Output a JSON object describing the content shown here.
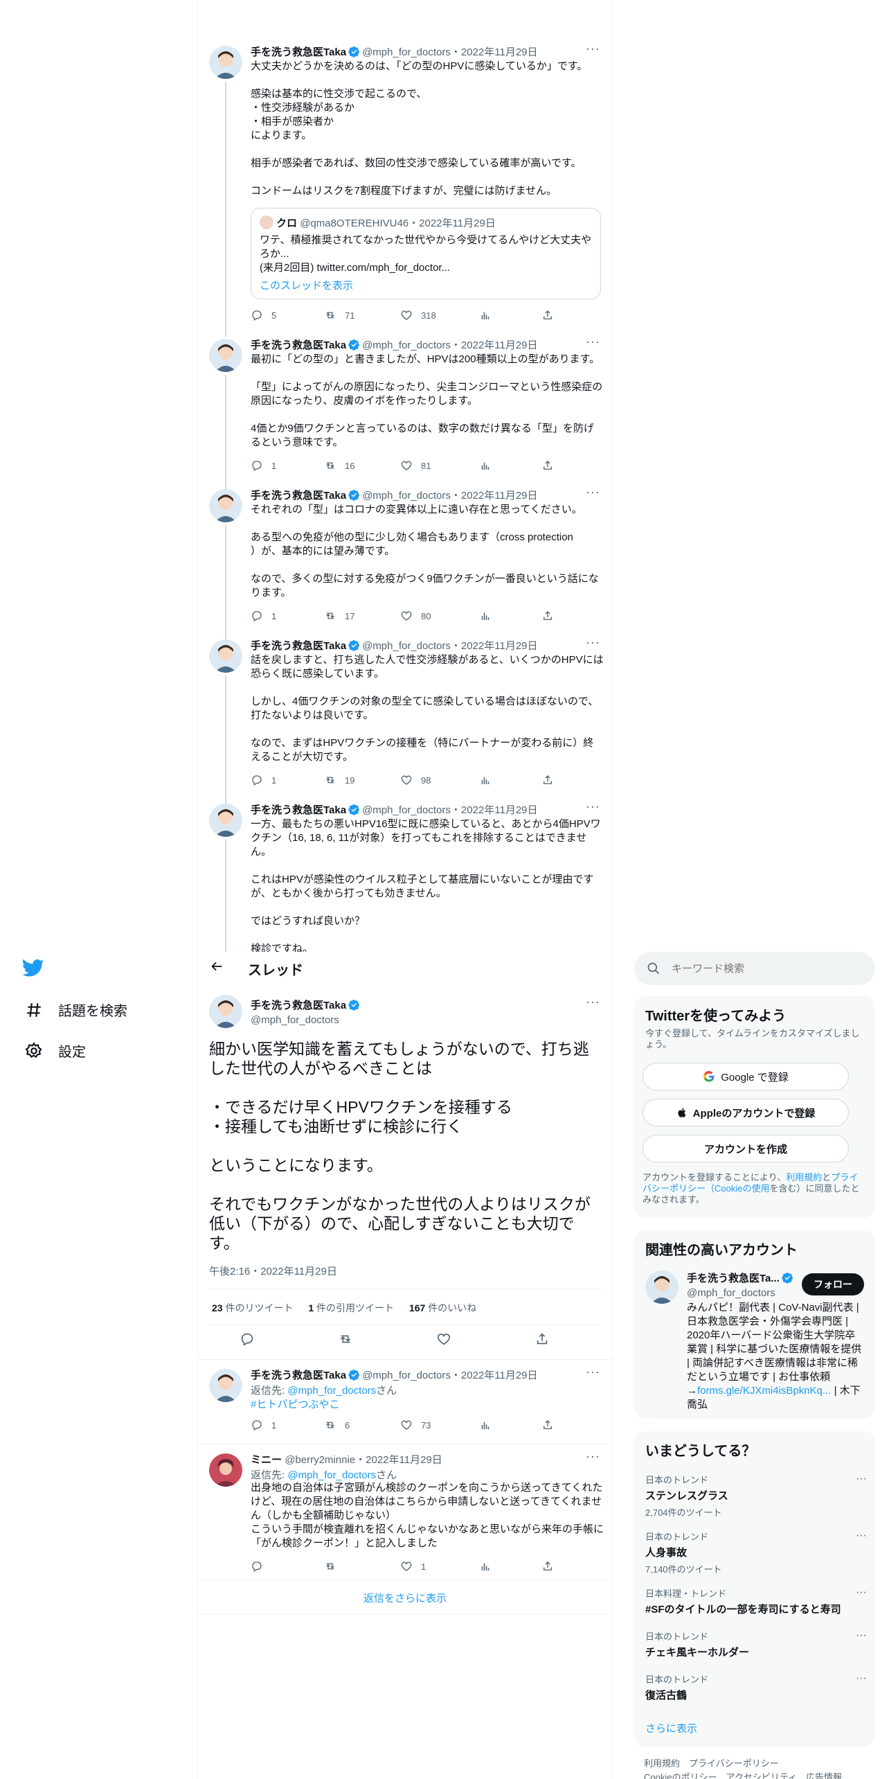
{
  "thread_tweets": [
    {
      "name": "手を洗う救急医Taka",
      "handle": "@mph_for_doctors",
      "date": "2022年11月29日",
      "body": "大丈夫かどうかを決めるのは、「どの型のHPVに感染しているか」です。\n\n感染は基本的に性交渉で起こるので、\n・性交渉経験があるか\n・相手が感染者か\nによります。\n\n相手が感染者であれば、数回の性交渉で感染している確率が高いです。\n\nコンドームはリスクを7割程度下げますが、完璧には防げません。",
      "quote": {
        "name": "クロ",
        "handle": "@qma8OTEREHIVU46",
        "date": "2022年11月29日",
        "text": "ワテ、積極推奨されてなかった世代やから今受けてるんやけど大丈夫やろか...\n(来月2回目) twitter.com/mph_for_doctor...",
        "show_thread": "このスレッドを表示"
      },
      "replies": "5",
      "retweets": "71",
      "likes": "318"
    },
    {
      "name": "手を洗う救急医Taka",
      "handle": "@mph_for_doctors",
      "date": "2022年11月29日",
      "body": "最初に「どの型の」と書きましたが、HPVは200種類以上の型があります。\n\n「型」によってがんの原因になったり、尖圭コンジローマという性感染症の原因になったり、皮膚のイボを作ったりします。\n\n4価とか9価ワクチンと言っているのは、数字の数だけ異なる「型」を防げるという意味です。",
      "replies": "1",
      "retweets": "16",
      "likes": "81"
    },
    {
      "name": "手を洗う救急医Taka",
      "handle": "@mph_for_doctors",
      "date": "2022年11月29日",
      "body": "それぞれの「型」はコロナの変異体以上に遠い存在と思ってください。\n\nある型への免疫が他の型に少し効く場合もあります（cross protection\n）が、基本的には望み薄です。\n\nなので、多くの型に対する免疫がつく9価ワクチンが一番良いという話になります。",
      "replies": "1",
      "retweets": "17",
      "likes": "80"
    },
    {
      "name": "手を洗う救急医Taka",
      "handle": "@mph_for_doctors",
      "date": "2022年11月29日",
      "body": "話を戻しますと、打ち逃した人で性交渉経験があると、いくつかのHPVには恐らく既に感染しています。\n\nしかし、4価ワクチンの対象の型全てに感染している場合はほぼないので、打たないよりは良いです。\n\nなので、まずはHPVワクチンの接種を（特にパートナーが変わる前に）終えることが大切です。",
      "replies": "1",
      "retweets": "19",
      "likes": "98"
    },
    {
      "name": "手を洗う救急医Taka",
      "handle": "@mph_for_doctors",
      "date": "2022年11月29日",
      "body": "一方、最もたちの悪いHPV16型に既に感染していると、あとから4価HPVワクチン（16, 18, 6, 11が対象）を打ってもこれを排除することはできません。\n\nこれはHPVが感染性のウイルス粒子として基底層にいないことが理由ですが、ともかく後から打っても効きません。\n\nではどうすれば良いか？\n\n検診ですね。"
    }
  ],
  "nav": {
    "explore_label": "話題を検索",
    "settings_label": "設定"
  },
  "header": {
    "title": "スレッド"
  },
  "main_tweet": {
    "name": "手を洗う救急医Taka",
    "handle": "@mph_for_doctors",
    "body": "細かい医学知識を蓄えてもしょうがないので、打ち逃した世代の人がやるべきことは\n\n・できるだけ早くHPVワクチンを接種する\n・接種しても油断せずに検診に行く\n\nということになります。\n\nそれでもワクチンがなかった世代の人よりはリスクが低い（下がる）ので、心配しすぎないことも大切です。",
    "timestamp": "午後2:16・2022年11月29日",
    "retweet_count": "23",
    "retweet_label": "件のリツイート",
    "quote_count": "1",
    "quote_label": "件の引用ツイート",
    "like_count": "167",
    "like_label": "件のいいね"
  },
  "replies": [
    {
      "name": "手を洗う救急医Taka",
      "handle": "@mph_for_doctors",
      "date": "2022年11月29日",
      "reply_prefix": "返信先: ",
      "reply_to": "@mph_for_doctors",
      "reply_suffix": "さん",
      "body": "#ヒトパピつぶやこ",
      "replies": "1",
      "retweets": "6",
      "likes": "73"
    },
    {
      "name": "ミニー",
      "handle": "@berry2minnie",
      "date": "2022年11月29日",
      "reply_prefix": "返信先: ",
      "reply_to": "@mph_for_doctors",
      "reply_suffix": "さん",
      "body": "出身地の自治体は子宮頸がん検診のクーポンを向こうから送ってきてくれたけど、現在の居住地の自治体はこちらから申請しないと送ってきてくれません（しかも全額補助じゃない）\nこういう手間が検査離れを招くんじゃないかなあと思いながら来年の手帳に「がん検診クーポン！」と記入しました",
      "replies": "",
      "retweets": "",
      "likes": "1"
    }
  ],
  "show_more_replies": "返信をさらに表示",
  "search": {
    "placeholder": "キーワード検索"
  },
  "signup": {
    "title": "Twitterを使ってみよう",
    "subtitle": "今すぐ登録して、タイムラインをカスタマイズしましょう。",
    "google_button": "Google で登録",
    "apple_button": "Appleのアカウントで登録",
    "create_button": "アカウントを作成",
    "legal_prefix": "アカウントを登録することにより、",
    "legal_terms": "利用規約",
    "legal_and": "と",
    "legal_privacy": "プライバシーポリシー（Cookieの使用",
    "legal_suffix": "を含む）に同意したとみなされます。"
  },
  "related": {
    "title": "関連性の高いアカウント",
    "name": "手を洗う救急医Ta...",
    "handle": "@mph_for_doctors",
    "follow_label": "フォロー",
    "bio_prefix": "みんパピ！副代表 | CoV-Navi副代表 | 日本救急医学会・外傷学会専門医 | 2020年ハーバード公衆衛生大学院卒業賞 | 科学に基づいた医療情報を提供 | 両論併記すべき医療情報は非常に稀だという立場です | お仕事依頼→",
    "bio_link": "forms.gle/KJXmi4isBpknKq...",
    "bio_suffix": " | 木下喬弘"
  },
  "trends": {
    "title": "いまどうしてる？",
    "items": [
      {
        "category": "日本のトレンド",
        "title": "ステンレスグラス",
        "count": "2,704件のツイート"
      },
      {
        "category": "日本のトレンド",
        "title": "人身事故",
        "count": "7,140件のツイート"
      },
      {
        "category": "日本料理・トレンド",
        "title": "#SFのタイトルの一部を寿司にすると寿司",
        "count": ""
      },
      {
        "category": "日本のトレンド",
        "title": "チェキ風キーホルダー",
        "count": ""
      },
      {
        "category": "日本のトレンド",
        "title": "復活古鶴",
        "count": ""
      }
    ],
    "show_more": "さらに表示"
  },
  "footer": {
    "line1": "利用規約　プライバシーポリシー",
    "line2": "Cookieのポリシー　アクセシビリティ　広告情報"
  },
  "colors": {
    "accent": "#1d9bf0",
    "text": "#0f1419",
    "secondary": "#536471",
    "border": "#eff3f4",
    "thread_line": "#cfd9de"
  }
}
